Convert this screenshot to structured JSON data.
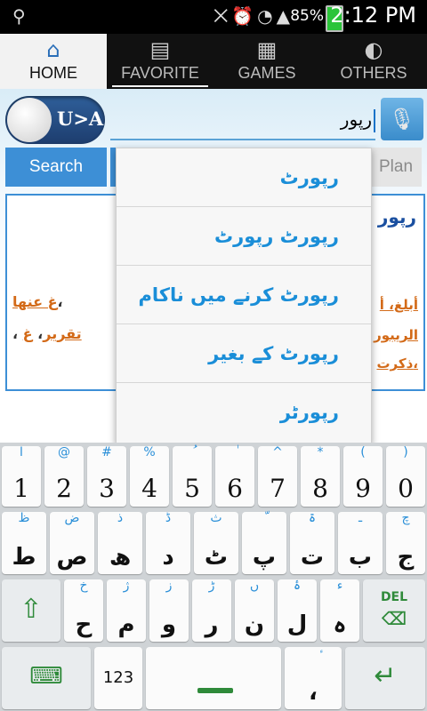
{
  "status_bar": {
    "battery_percent": "85%",
    "time": "2:12 PM"
  },
  "tabs": [
    {
      "label": "HOME",
      "icon": "home-icon",
      "active": true
    },
    {
      "label": "FAVORITE",
      "icon": "clipboard-icon",
      "active": false
    },
    {
      "label": "GAMES",
      "icon": "abacus-icon",
      "active": false
    },
    {
      "label": "OTHERS",
      "icon": "pie-icon",
      "active": false
    }
  ],
  "toggle": {
    "label": "U>A"
  },
  "search": {
    "value": "رپور"
  },
  "buttons": {
    "search_label": "Search",
    "plan_label": "Plan"
  },
  "result": {
    "heading": "رپور",
    "line1": "أبلغ، أ",
    "line2": "الريبور",
    "line3": "ذكرت،",
    "left1_link": "غ عنها",
    "left2_link1": "غ",
    "left2_link2": "تقرير"
  },
  "suggestions": [
    "رپورٹ",
    "رپورٹ رپورٹ",
    "رپورٹ کرنے میں ناکام",
    "رپورٹ کے بغیر",
    "رپورٹر"
  ],
  "keyboard": {
    "row1": [
      {
        "main": "1",
        "sub": "ا"
      },
      {
        "main": "2",
        "sub": "@"
      },
      {
        "main": "3",
        "sub": "#"
      },
      {
        "main": "4",
        "sub": "%"
      },
      {
        "main": "5",
        "sub": "ُ"
      },
      {
        "main": "6",
        "sub": "ٰ"
      },
      {
        "main": "7",
        "sub": "^"
      },
      {
        "main": "8",
        "sub": "*"
      },
      {
        "main": "9",
        "sub": "("
      },
      {
        "main": "0",
        "sub": ")"
      }
    ],
    "row1_extra": {
      "sub": "~"
    },
    "row2": [
      {
        "main": "ط",
        "sub": "ظ"
      },
      {
        "main": "ص",
        "sub": "ض"
      },
      {
        "main": "ھ",
        "sub": "ذ"
      },
      {
        "main": "د",
        "sub": "ڈ"
      },
      {
        "main": "ٹ",
        "sub": "ث"
      },
      {
        "main": "پ",
        "sub": "ّ"
      },
      {
        "main": "ت",
        "sub": "ۃ"
      },
      {
        "main": "ب",
        "sub": "ـ"
      },
      {
        "main": "ج",
        "sub": "چ"
      }
    ],
    "row3": [
      {
        "main": "ح",
        "sub": "خ"
      },
      {
        "main": "م",
        "sub": "ژ"
      },
      {
        "main": "و",
        "sub": "ز"
      },
      {
        "main": "ر",
        "sub": "ڑ"
      },
      {
        "main": "ن",
        "sub": "ں"
      },
      {
        "main": "ل",
        "sub": "ۂ"
      },
      {
        "main": "ہ",
        "sub": "ء"
      }
    ],
    "del_label": "DEL",
    "num_label": "123",
    "comma_main": "،",
    "comma_sub": "ٔ"
  }
}
